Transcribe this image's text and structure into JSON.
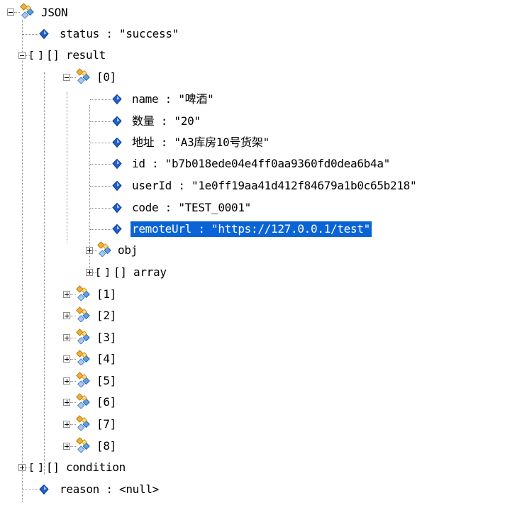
{
  "tree": {
    "root": "JSON",
    "status": {
      "key": "status",
      "value": "\"success\""
    },
    "result": {
      "label": "[] result",
      "item0": {
        "label": "[0]",
        "fields": [
          "name : \"啤酒\"",
          "数量 : \"20\"",
          "地址 : \"A3库房10号货架\"",
          "id : \"b7b018ede04e4ff0aa9360fd0dea6b4a\"",
          "userId : \"1e0ff19aa41d412f84679a1b0c65b218\"",
          "code : \"TEST_0001\"",
          "remoteUrl : \"https://127.0.0.1/test\""
        ],
        "obj": "obj",
        "array": "[] array"
      },
      "items": [
        "[1]",
        "[2]",
        "[3]",
        "[4]",
        "[5]",
        "[6]",
        "[7]",
        "[8]"
      ]
    },
    "condition": "[] condition",
    "reason": "reason : <null>"
  },
  "selected": "remoteUrl : \"https://127.0.0.1/test\"",
  "colors": {
    "selection": "#0a64d6",
    "value_icon": "#1f5fd0",
    "object_icon_blue": "#5aa0e8",
    "object_icon_orange": "#f2b133"
  }
}
